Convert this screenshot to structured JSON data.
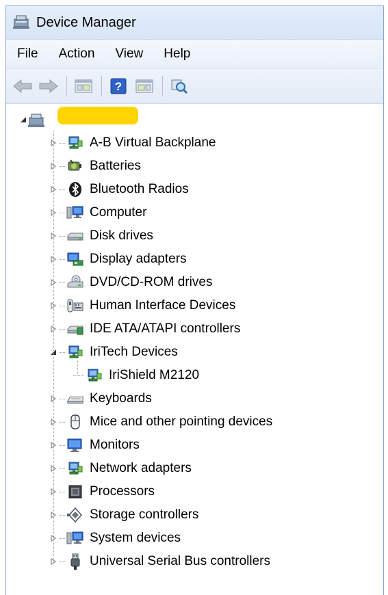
{
  "window": {
    "title": "Device Manager"
  },
  "menu": [
    "File",
    "Action",
    "View",
    "Help"
  ],
  "toolbar": [
    {
      "icon": "back-arrow-icon"
    },
    {
      "icon": "forward-arrow-icon"
    },
    {
      "icon": "show-hide-console-tree-icon"
    },
    {
      "icon": "help-icon"
    },
    {
      "icon": "action-pane-icon"
    },
    {
      "icon": "scan-hardware-changes-icon"
    }
  ],
  "tree": {
    "root": {
      "label": "",
      "redacted": true,
      "expanded": true
    },
    "categories": [
      {
        "label": "A-B Virtual Backplane",
        "icon": "network-card-icon",
        "expanded": false
      },
      {
        "label": "Batteries",
        "icon": "battery-icon",
        "expanded": false
      },
      {
        "label": "Bluetooth Radios",
        "icon": "bluetooth-icon",
        "expanded": false
      },
      {
        "label": "Computer",
        "icon": "computer-icon",
        "expanded": false
      },
      {
        "label": "Disk drives",
        "icon": "disk-drive-icon",
        "expanded": false
      },
      {
        "label": "Display adapters",
        "icon": "display-adapter-icon",
        "expanded": false
      },
      {
        "label": "DVD/CD-ROM drives",
        "icon": "dvd-drive-icon",
        "expanded": false
      },
      {
        "label": "Human Interface Devices",
        "icon": "hid-icon",
        "expanded": false
      },
      {
        "label": "IDE ATA/ATAPI controllers",
        "icon": "ide-controller-icon",
        "expanded": false
      },
      {
        "label": "IriTech Devices",
        "icon": "network-card-icon",
        "expanded": true,
        "children": [
          {
            "label": "IriShield M2120",
            "icon": "network-card-icon"
          }
        ]
      },
      {
        "label": "Keyboards",
        "icon": "keyboard-icon",
        "expanded": false
      },
      {
        "label": "Mice and other pointing devices",
        "icon": "mouse-icon",
        "expanded": false
      },
      {
        "label": "Monitors",
        "icon": "monitor-icon",
        "expanded": false
      },
      {
        "label": "Network adapters",
        "icon": "network-card-icon",
        "expanded": false
      },
      {
        "label": "Processors",
        "icon": "processor-icon",
        "expanded": false
      },
      {
        "label": "Storage controllers",
        "icon": "storage-controller-icon",
        "expanded": false
      },
      {
        "label": "System devices",
        "icon": "computer-icon",
        "expanded": false
      },
      {
        "label": "Universal Serial Bus controllers",
        "icon": "usb-icon",
        "expanded": false
      }
    ]
  }
}
